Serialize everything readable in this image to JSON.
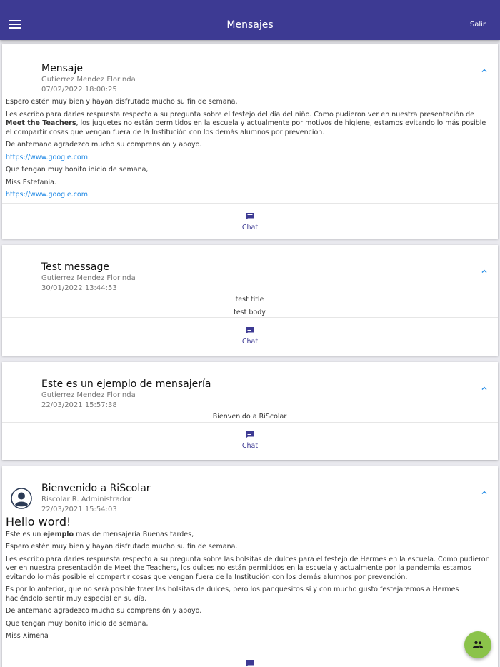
{
  "header": {
    "title": "Mensajes",
    "logout_label": "Salir"
  },
  "messages": [
    {
      "subject": "Mensaje",
      "sender": "Gutierrez Mendez Florinda",
      "date": "07/02/2022 18:00:25",
      "body": {
        "p1": "Espero estén muy bien y hayan disfrutado mucho su fin de semana.",
        "p2_a": "Les escribo para darles respuesta respecto a su pregunta sobre el festejo del día del niño. Como pudieron ver en nuestra presentación de ",
        "p2_b": "Meet the Teachers",
        "p2_c": ", los juguetes no están permitidos en la escuela y actualmente por motivos de higiene, estamos evitando lo más posible el compartir cosas que vengan fuera de la Institución con los demás alumnos por prevención.",
        "p3": "De antemano agradezco mucho su comprensión y apoyo.",
        "link1": "https://www.google.com",
        "p4": "Que tengan muy bonito inicio de semana,",
        "p5": "Miss Estefania.",
        "link2": "https://www.google.com"
      },
      "chat_label": "Chat"
    },
    {
      "subject": "Test message",
      "sender": "Gutierrez Mendez Florinda",
      "date": "30/01/2022 13:44:53",
      "body": {
        "line1": "test title",
        "line2": "test body"
      },
      "chat_label": "Chat"
    },
    {
      "subject": "Este es un ejemplo de mensajería",
      "sender": "Gutierrez Mendez Florinda",
      "date": "22/03/2021 15:57:38",
      "body": {
        "line1": "Bienvenido a RiScolar"
      },
      "chat_label": "Chat"
    },
    {
      "subject": "Bienvenido a RiScolar",
      "sender": "Riscolar R. Administrador",
      "date": "22/03/2021 15:54:03",
      "body": {
        "heading": "Hello word!",
        "p1_a": " Este es un ",
        "p1_b": "ejemplo",
        "p1_c": " mas de mensajería Buenas tardes,",
        "p2": "Espero estén muy bien y hayan disfrutado mucho su fin de semana.",
        "p3": "Les escribo para darles respuesta respecto a su pregunta sobre las bolsitas de dulces para el festejo de Hermes en la escuela. Como pudieron ver en nuestra presentación de Meet the Teachers, los dulces no están permitidos en la escuela y actualmente por la pandemia estamos evitando lo más posible el compartir cosas que vengan fuera de la Institución con los demás alumnos por prevención.",
        "p4": "Es por lo anterior, que no será posible traer las bolsitas de dulces, pero los panquesitos sí y con mucho gusto festejaremos a Hermes haciéndolo sentir muy especial en su día.",
        "p5": "De antemano agradezco mucho su comprensión y apoyo.",
        "p6": "Que tengan muy bonito inicio de semana,",
        "p7": "Miss Ximena"
      }
    }
  ],
  "icons": {
    "menu": "menu-icon",
    "chevron": "chevron-up-icon",
    "chat": "chat-icon",
    "avatar": "account-circle-icon",
    "fab": "group-icon"
  },
  "colors": {
    "primary": "#3d3a93",
    "link": "#1e88e5",
    "fab": "#8bc34a"
  }
}
